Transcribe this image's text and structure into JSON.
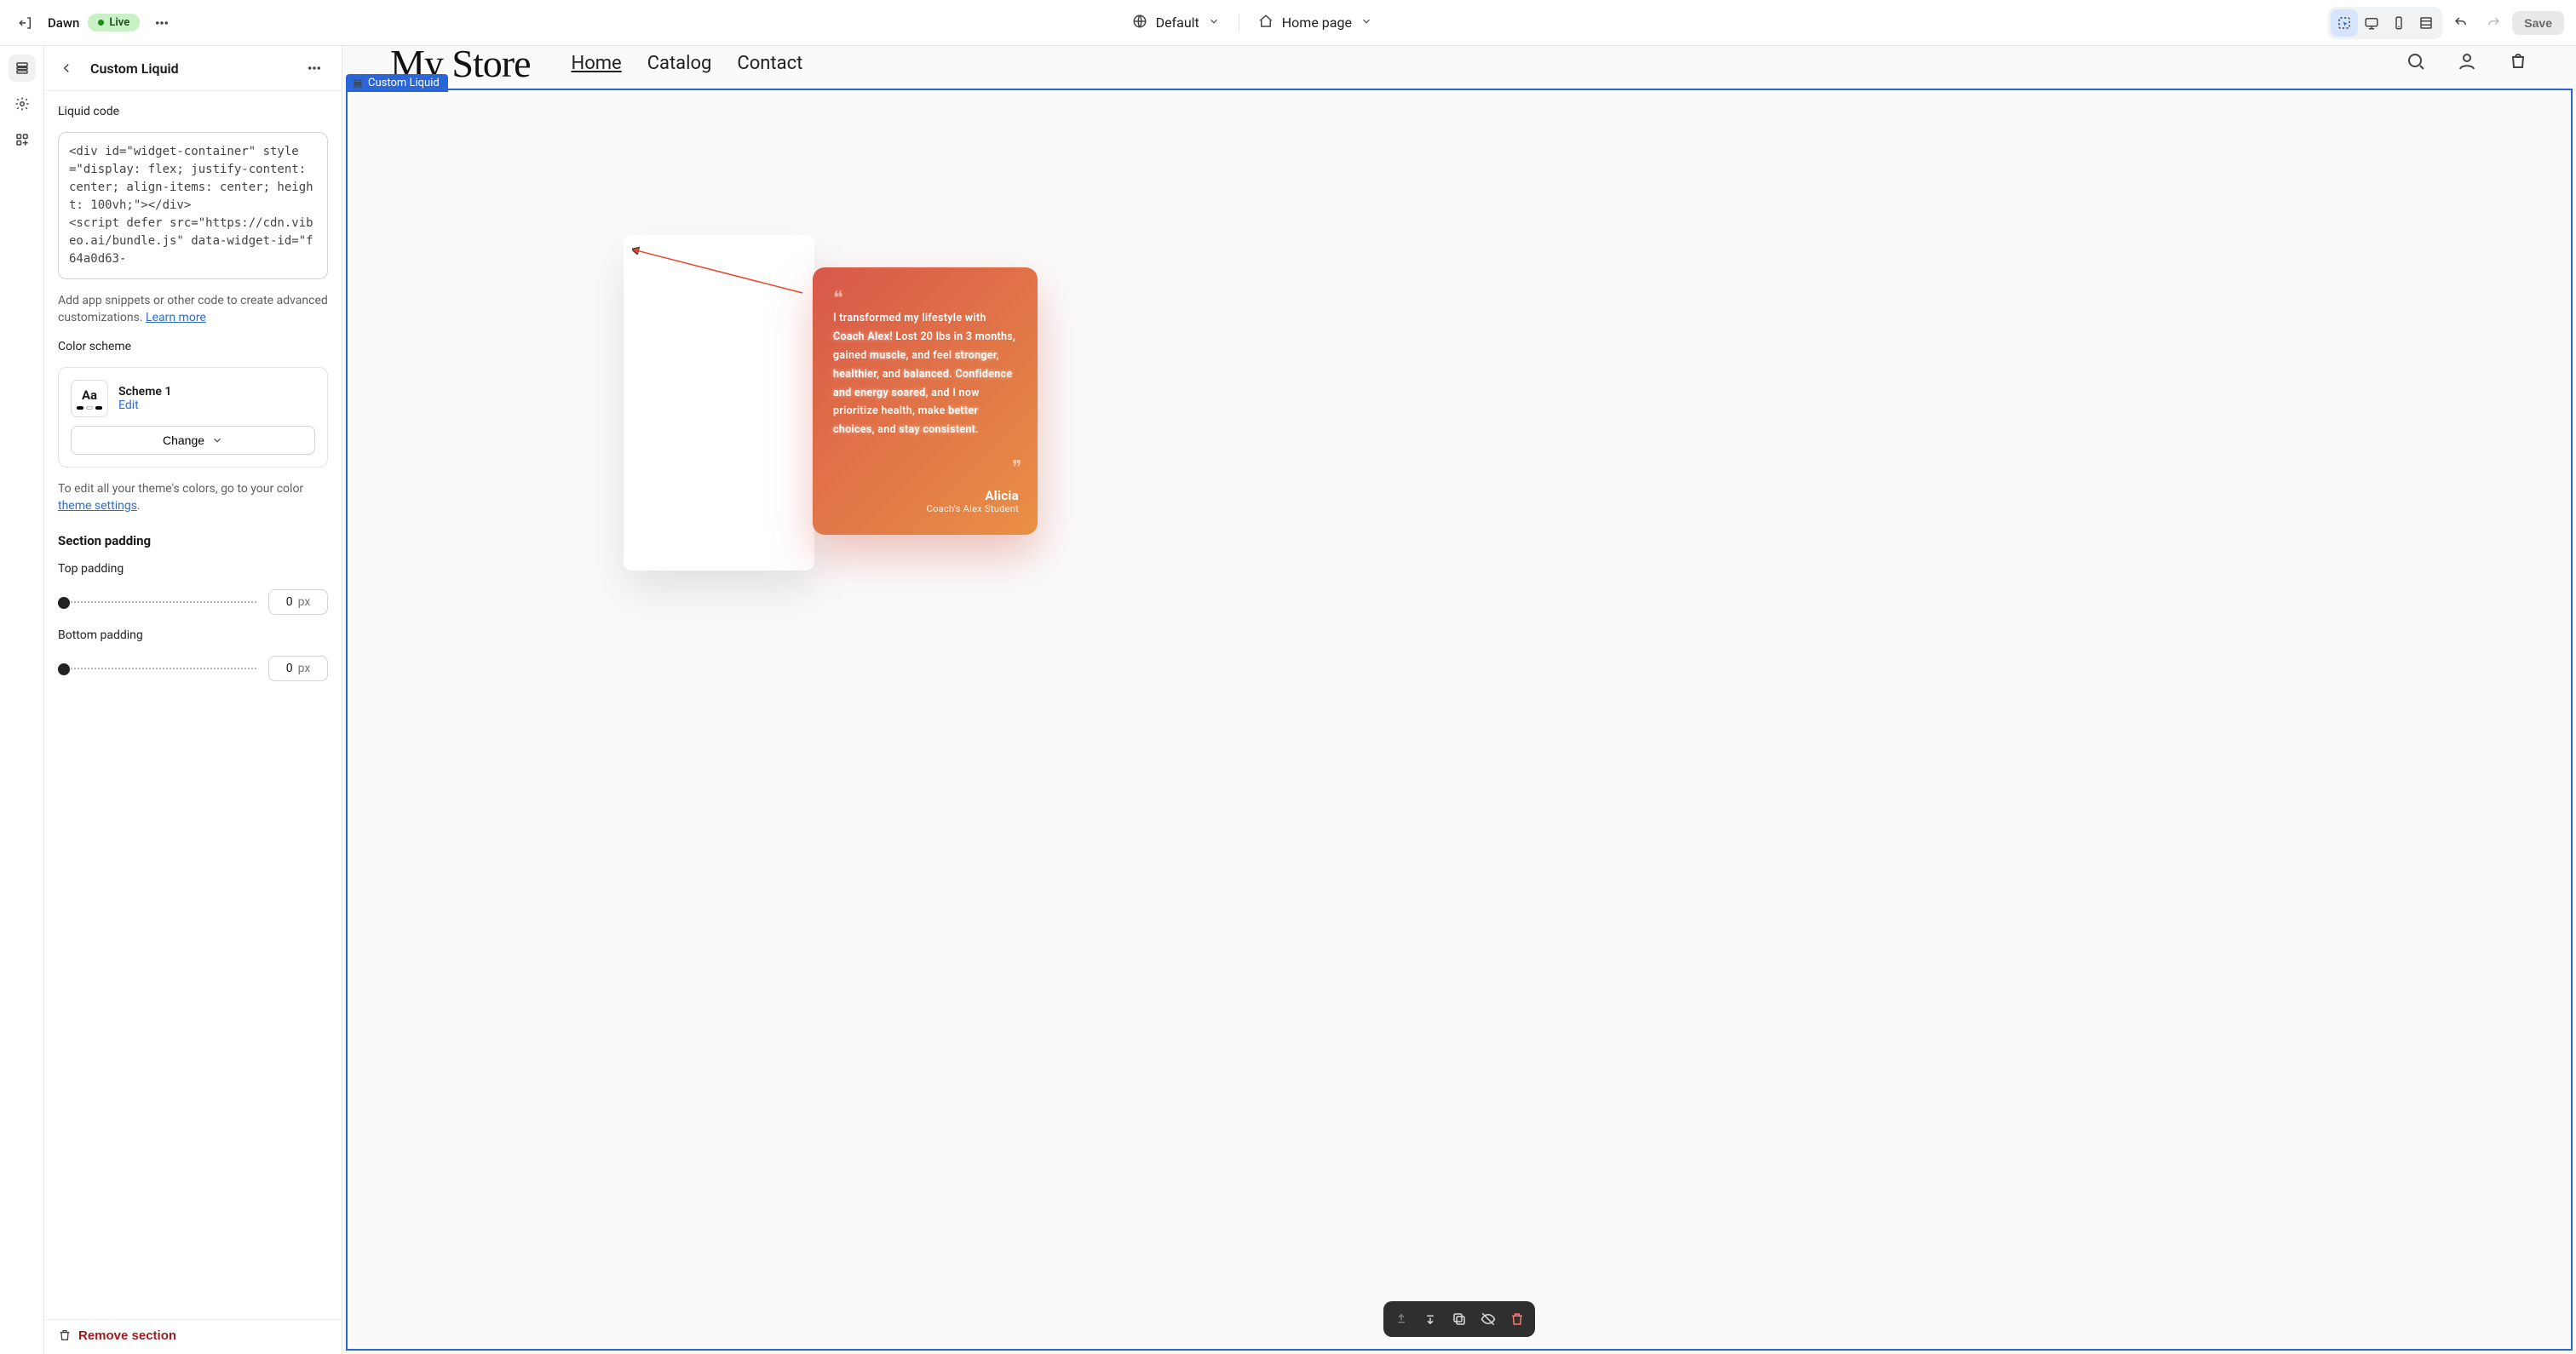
{
  "topbar": {
    "theme_name": "Dawn",
    "live_badge": "Live",
    "locale_label": "Default",
    "page_label": "Home page",
    "save_label": "Save"
  },
  "panel": {
    "title": "Custom Liquid",
    "code_label": "Liquid code",
    "code_value": "<div id=\"widget-container\" style=\"display: flex; justify-content: center; align-items: center; height: 100vh;\"></div>\n<script defer src=\"https://cdn.vibeo.ai/bundle.js\" data-widget-id=\"f64a0d63-",
    "help_text": "Add app snippets or other code to create advanced customizations. ",
    "learn_more": "Learn more",
    "color_scheme_label": "Color scheme",
    "scheme_name": "Scheme 1",
    "edit_label": "Edit",
    "change_label": "Change",
    "theme_colors_text": "To edit all your theme's colors, go to your color ",
    "theme_settings_link": "theme settings",
    "section_padding_heading": "Section padding",
    "top_padding_label": "Top padding",
    "top_padding_value": "0",
    "bottom_padding_label": "Bottom padding",
    "bottom_padding_value": "0",
    "px_unit": "px",
    "remove_section_label": "Remove section"
  },
  "preview": {
    "brand": "My Store",
    "nav": {
      "home": "Home",
      "catalog": "Catalog",
      "contact": "Contact"
    },
    "section_tag": "Custom Liquid",
    "testimonial": {
      "text_parts": [
        {
          "t": "I transformed my lifestyle with ",
          "e": false
        },
        {
          "t": "Coach Alex!",
          "e": true
        },
        {
          "t": " Lost 20 lbs in 3 months, gained ",
          "e": false
        },
        {
          "t": "muscle",
          "e": true
        },
        {
          "t": ", and feel ",
          "e": false
        },
        {
          "t": "stronger",
          "e": true
        },
        {
          "t": ", ",
          "e": false
        },
        {
          "t": "healthier",
          "e": true
        },
        {
          "t": ", and ",
          "e": false
        },
        {
          "t": "balanced",
          "e": true
        },
        {
          "t": ". ",
          "e": false
        },
        {
          "t": "Confidence and energy soared",
          "e": true
        },
        {
          "t": ", and I now prioritize health, make ",
          "e": false
        },
        {
          "t": "better choices",
          "e": true
        },
        {
          "t": ", and ",
          "e": false
        },
        {
          "t": "stay consistent",
          "e": true
        },
        {
          "t": ".",
          "e": false
        }
      ],
      "name": "Alicia",
      "role": "Coach's Alex Student"
    }
  }
}
